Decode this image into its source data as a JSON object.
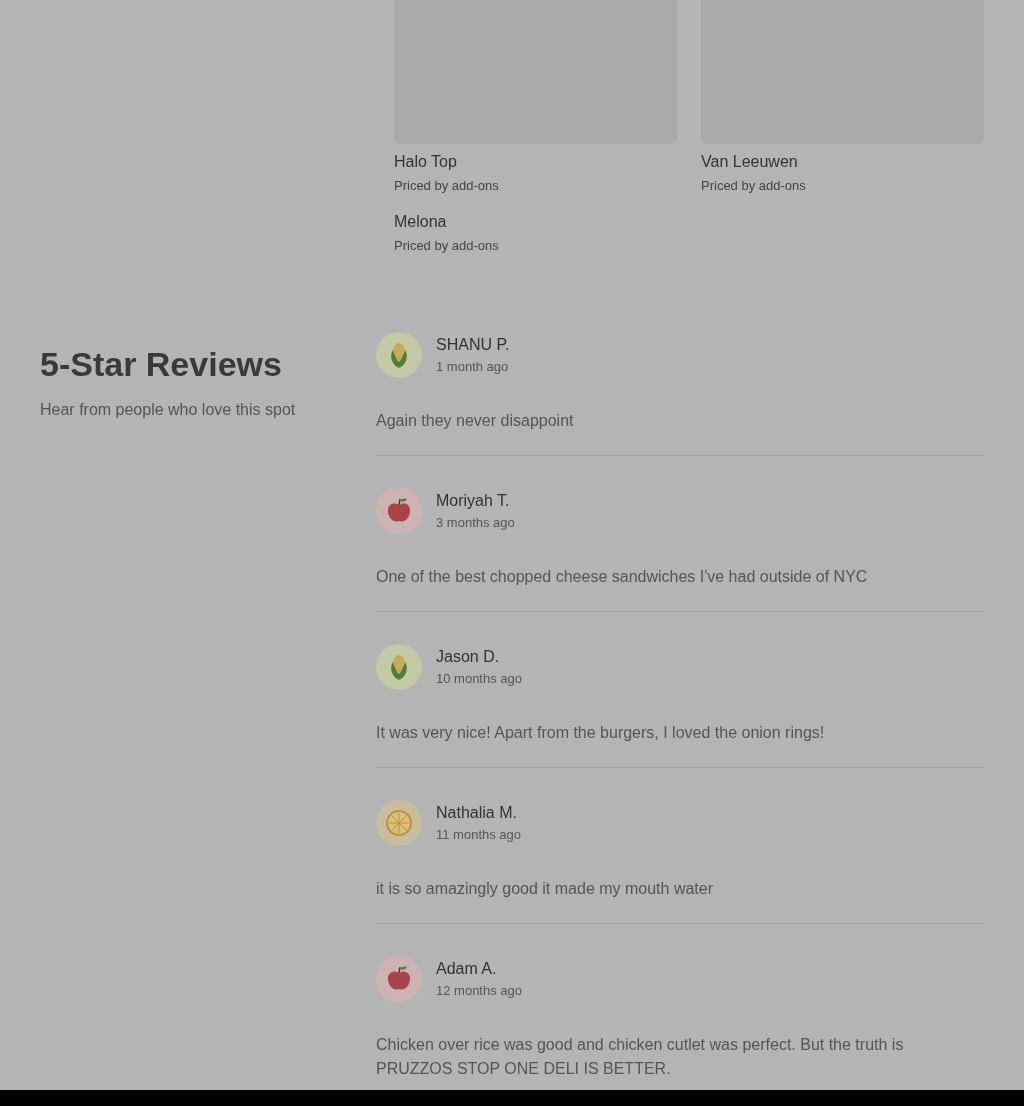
{
  "products": [
    {
      "name": "Halo Top",
      "price": "Priced by add-ons",
      "image": true
    },
    {
      "name": "Van Leeuwen",
      "price": "Priced by add-ons",
      "image": true
    },
    {
      "name": "Melona",
      "price": "Priced by add-ons",
      "image": false
    }
  ],
  "reviews_section": {
    "title": "5-Star Reviews",
    "subtitle": "Hear from people who love this spot"
  },
  "reviews": [
    {
      "name": "SHANU P.",
      "time": "1 month ago",
      "text": "Again they never disappoint",
      "kind": "corn"
    },
    {
      "name": "Moriyah T.",
      "time": "3 months ago",
      "text": "One of the best chopped cheese sandwiches I've had outside of NYC",
      "kind": "apple"
    },
    {
      "name": "Jason D.",
      "time": "10 months ago",
      "text": "It was very nice! Apart from the burgers, I loved the onion rings!",
      "kind": "corn"
    },
    {
      "name": "Nathalia M.",
      "time": "11 months ago",
      "text": "it is so amazingly good it made my mouth water",
      "kind": "citrus"
    },
    {
      "name": "Adam A.",
      "time": "12 months ago",
      "text": "Chicken over rice was good and chicken cutlet was perfect. But the truth is PRUZZOS STOP ONE DELI IS BETTER.",
      "kind": "apple"
    }
  ]
}
